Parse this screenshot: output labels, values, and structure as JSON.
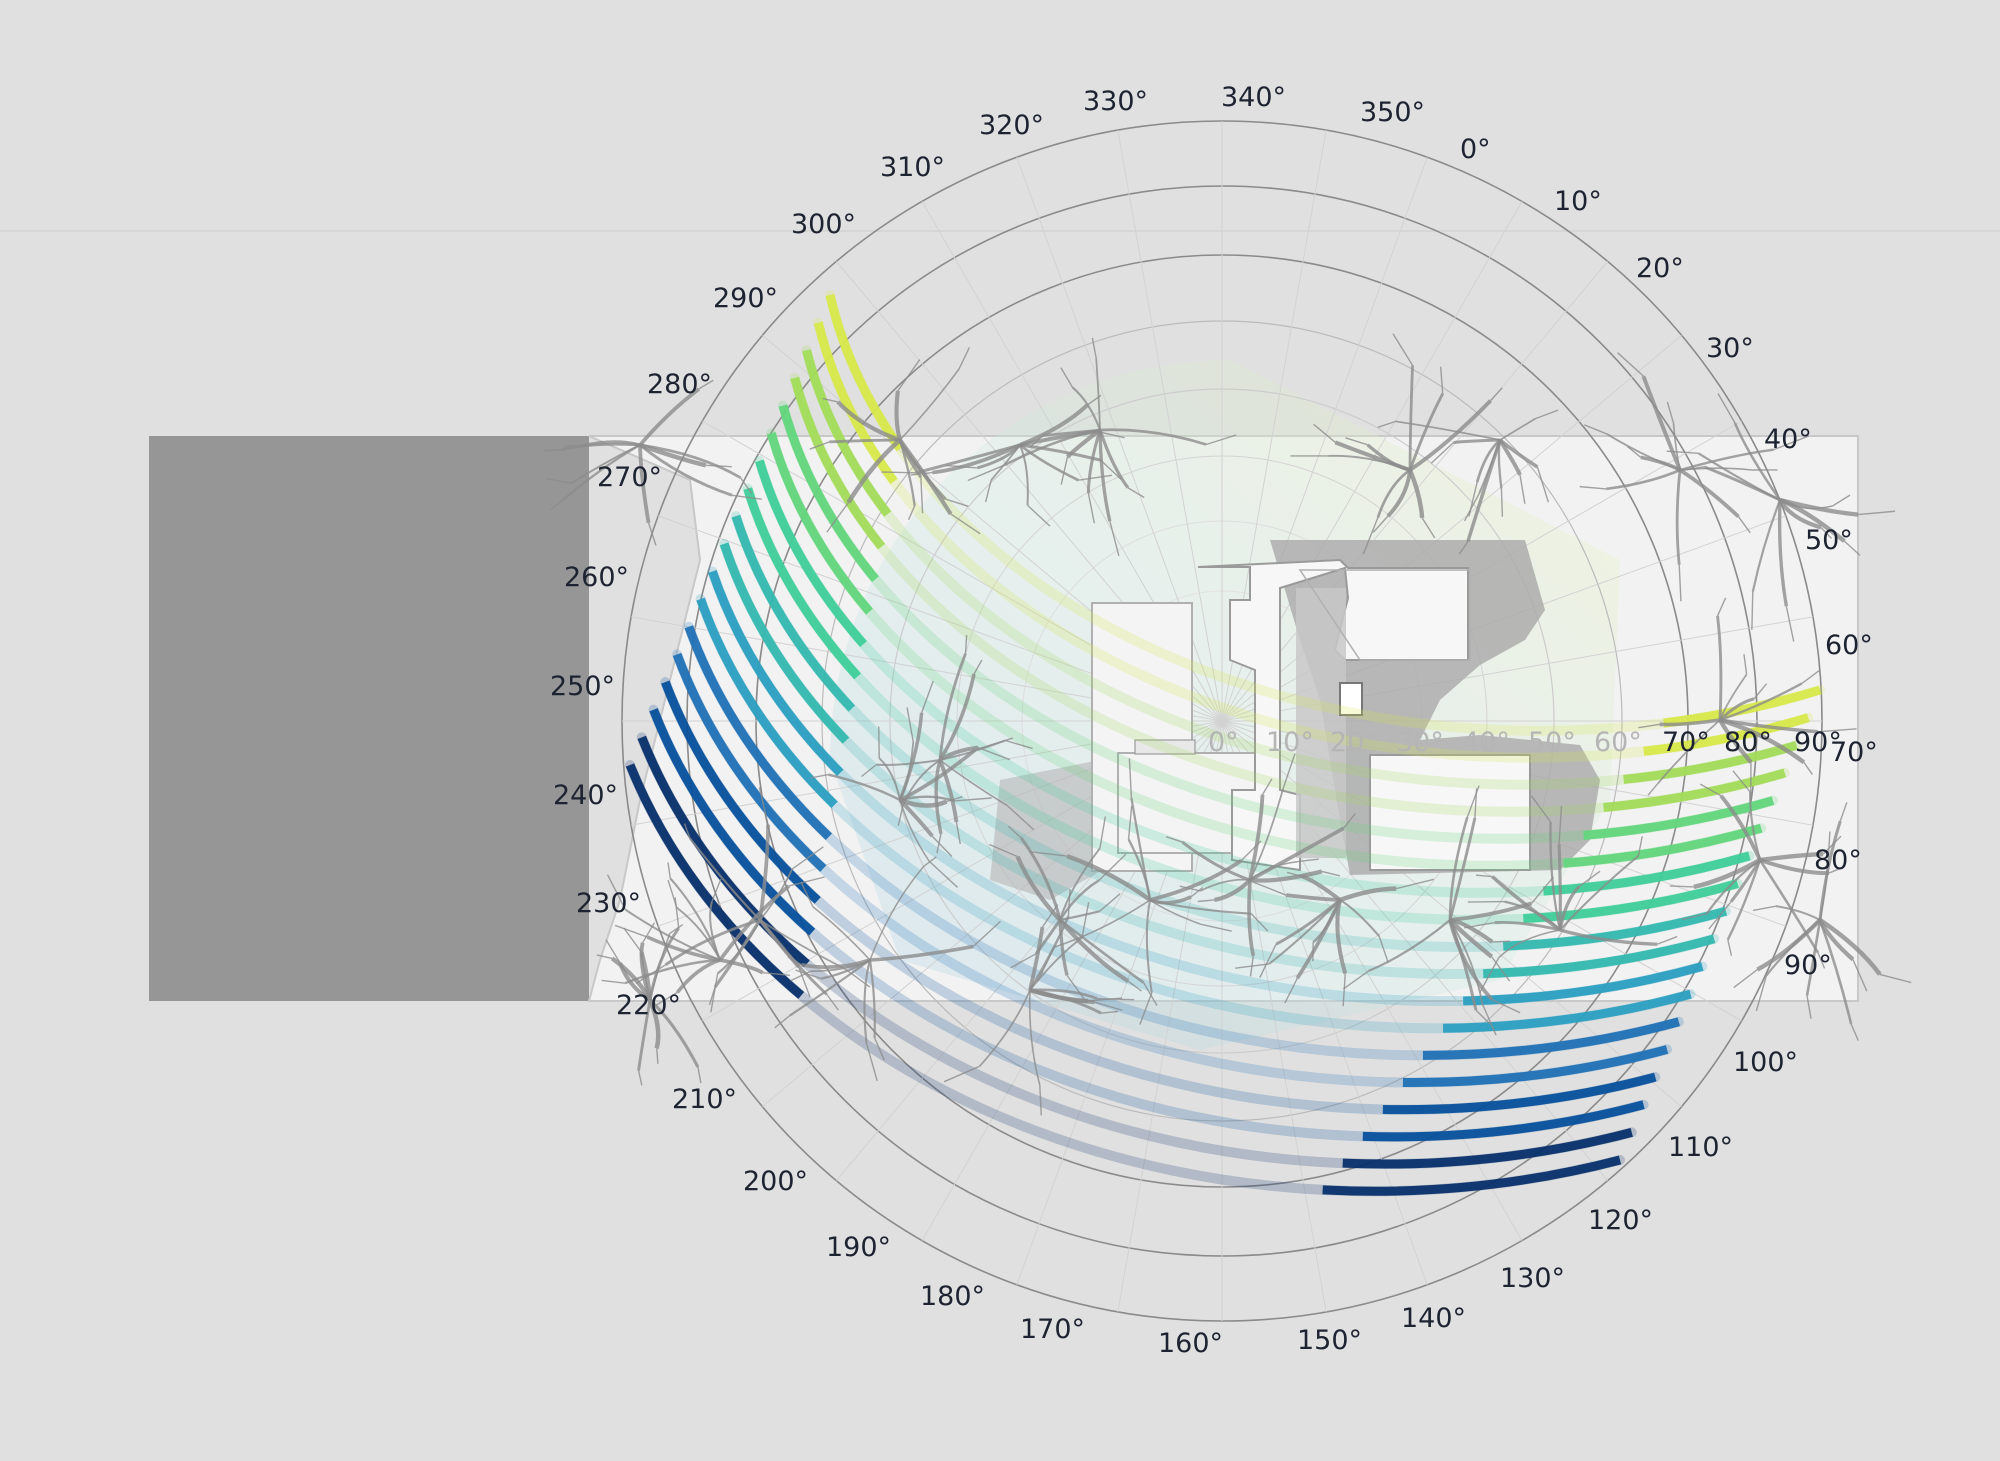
{
  "diagram": {
    "outer_labels": {
      "upper_ring": [
        "0°",
        "10°",
        "20°",
        "30°",
        "40°",
        "50°",
        "60°",
        "70°",
        "80°",
        "90°",
        "100°",
        "110°",
        "120°",
        "130°",
        "140°",
        "150°",
        "160°",
        "170°",
        "180°",
        "190°",
        "200°",
        "210°",
        "220°",
        "230°",
        "240°",
        "250°",
        "260°",
        "270°",
        "280°",
        "290°",
        "300°",
        "310°",
        "320°",
        "330°",
        "340°",
        "350°"
      ],
      "right_edge": [
        "70°",
        "80°",
        "90°"
      ]
    },
    "inner_labels": [
      "0°",
      "10°",
      "20°",
      "30°",
      "40°",
      "50°",
      "60°",
      "70°",
      "80°",
      "90°"
    ],
    "colors": {
      "background": "#e0e0e0",
      "site": "#f2f2f2",
      "neighbor_block": "#969696",
      "ring_line": "#8a8a8a",
      "building_shadow": "#a9a9a9",
      "tree": "#8c8c8c",
      "sun_path_gradient": [
        "#08306b",
        "#08519c",
        "#2171b5",
        "#2c9fc1",
        "#35b8b0",
        "#3fcf9a",
        "#63d67c",
        "#a2dc5a",
        "#d7e84a"
      ]
    }
  }
}
